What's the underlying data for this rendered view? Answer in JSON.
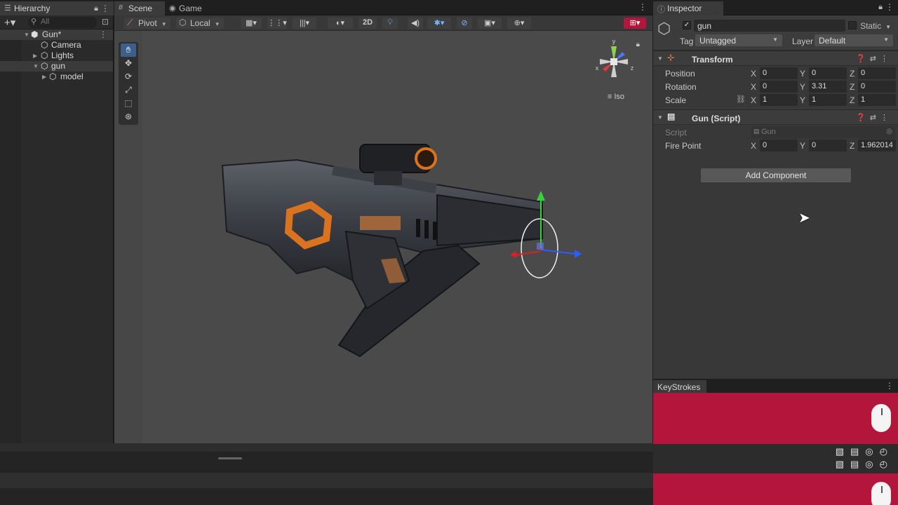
{
  "hierarchy": {
    "tab_label": "Hierarchy",
    "search_placeholder": "All",
    "items": [
      {
        "label": "Gun*",
        "depth": 0
      },
      {
        "label": "Camera",
        "depth": 1
      },
      {
        "label": "Lights",
        "depth": 1
      },
      {
        "label": "gun",
        "depth": 1
      },
      {
        "label": "model",
        "depth": 2
      }
    ]
  },
  "scene": {
    "tab_scene": "Scene",
    "tab_game": "Game",
    "pivot_label": "Pivot",
    "local_label": "Local",
    "mode_2d": "2D",
    "gizmo_view": "Iso",
    "gizmo_axes": {
      "x": "x",
      "y": "y",
      "z": "z"
    }
  },
  "inspector": {
    "tab_label": "Inspector",
    "object_name": "gun",
    "static_label": "Static",
    "tag_label": "Tag",
    "tag_value": "Untagged",
    "layer_label": "Layer",
    "layer_value": "Default",
    "transform": {
      "title": "Transform",
      "position": {
        "label": "Position",
        "x": "0",
        "y": "0",
        "z": "0"
      },
      "rotation": {
        "label": "Rotation",
        "x": "0",
        "y": "3.31",
        "z": "0"
      },
      "scale": {
        "label": "Scale",
        "x": "1",
        "y": "1",
        "z": "1"
      }
    },
    "gun_script": {
      "title": "Gun (Script)",
      "script_label": "Script",
      "script_value": "Gun",
      "fire_point": {
        "label": "Fire Point",
        "x": "0",
        "y": "0",
        "z": "1.962014"
      }
    },
    "add_component": "Add Component"
  },
  "keystrokes": {
    "tab_label": "KeyStrokes"
  },
  "colors": {
    "keystroke_band": "#b3163a",
    "selection_blue": "#3c5f8c",
    "accent_orange": "#d9731f"
  }
}
